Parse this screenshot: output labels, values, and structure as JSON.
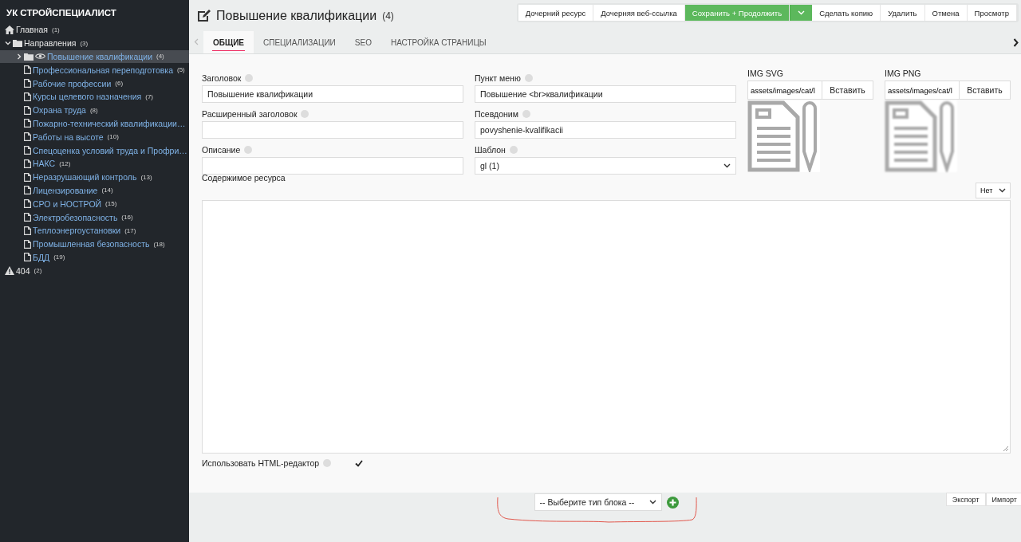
{
  "sidebar": {
    "title": "УК СТРОЙСПЕЦИАЛИСТ",
    "tree": [
      {
        "label": "Главная",
        "count": "(1)",
        "kind": "home",
        "selected": false
      },
      {
        "label": "Направления",
        "count": "(3)",
        "kind": "folder",
        "selected": false,
        "expanded": true,
        "children": [
          {
            "label": "Повышение квалификации",
            "count": "(4)",
            "kind": "folder",
            "selected": true,
            "expanded": false,
            "visible": true
          },
          {
            "label": "Профессиональная переподготовка",
            "count": "(5)",
            "kind": "file",
            "selected": false
          },
          {
            "label": "Рабочие профессии",
            "count": "(6)",
            "kind": "file",
            "selected": false
          },
          {
            "label": "Курсы целевого назначения",
            "count": "(7)",
            "kind": "file",
            "selected": false
          },
          {
            "label": "Охрана труда",
            "count": "(8)",
            "kind": "file",
            "selected": false
          },
          {
            "label": "Пожарно-технический квалификации…",
            "kind": "file",
            "selected": false
          },
          {
            "label": "Работы на высоте",
            "count": "(10)",
            "kind": "file",
            "selected": false
          },
          {
            "label": "Спецоценка условий труда и Профри…",
            "kind": "file",
            "selected": false
          },
          {
            "label": "НАКС",
            "count": "(12)",
            "kind": "file",
            "selected": false
          },
          {
            "label": "Неразрушающий контроль",
            "count": "(13)",
            "kind": "file",
            "selected": false
          },
          {
            "label": "Лицензирование",
            "count": "(14)",
            "kind": "file",
            "selected": false
          },
          {
            "label": "СРО и НОСТРОЙ",
            "count": "(15)",
            "kind": "file",
            "selected": false
          },
          {
            "label": "Электробезопасность",
            "count": "(16)",
            "kind": "file",
            "selected": false
          },
          {
            "label": "Теплоэнергоустановки",
            "count": "(17)",
            "kind": "file",
            "selected": false
          },
          {
            "label": "Промышленная безопасность",
            "count": "(18)",
            "kind": "file",
            "selected": false
          },
          {
            "label": "БДД",
            "count": "(19)",
            "kind": "file",
            "selected": false
          }
        ]
      },
      {
        "label": "404",
        "count": "(2)",
        "kind": "warning",
        "selected": false
      }
    ]
  },
  "header": {
    "title": "Повышение квалификации",
    "count": "(4)",
    "buttons": [
      {
        "label": "Дочерний ресурс",
        "kind": "plain"
      },
      {
        "label": "Дочерняя веб-ссылка",
        "kind": "plain"
      },
      {
        "label": "Сохранить + Продолжить",
        "kind": "primary"
      },
      {
        "label": "Сделать копию",
        "kind": "plain"
      },
      {
        "label": "Удалить",
        "kind": "plain"
      },
      {
        "label": "Отмена",
        "kind": "plain"
      },
      {
        "label": "Просмотр",
        "kind": "plain"
      }
    ]
  },
  "tabs": [
    {
      "label": "ОБЩИЕ",
      "selected": true
    },
    {
      "label": "СПЕЦИАЛИЗАЦИИ",
      "selected": false
    },
    {
      "label": "SEO",
      "selected": false
    },
    {
      "label": "НАСТРОЙКА СТРАНИЦЫ",
      "selected": false
    }
  ],
  "fields_left": [
    {
      "label": "Заголовок",
      "value": "Повышение квалификации",
      "kind": "text"
    },
    {
      "label": "Расширенный заголовок",
      "kind": "text"
    },
    {
      "label": "Описание",
      "kind": "text"
    }
  ],
  "fields_right": [
    {
      "label": "Пункт меню",
      "value": "Повышение  <br>квалификации",
      "kind": "text"
    },
    {
      "label": "Псевдоним",
      "value": "povyshenie-kvalifikacii",
      "kind": "text"
    },
    {
      "label": "Шаблон",
      "value": "gl (1)",
      "kind": "select"
    }
  ],
  "images": [
    {
      "label": "IMG SVG",
      "value": "assets/images/cat/l",
      "button": "Вставить",
      "blurred": false
    },
    {
      "label": "IMG PNG",
      "value": "assets/images/cat/l",
      "button": "Вставить",
      "blurred": true
    }
  ],
  "content": {
    "label": "Содержимое ресурса",
    "editor_select": "Нет"
  },
  "html_editor": {
    "label": "Использовать HTML-редактор",
    "checked": true
  },
  "footer": {
    "block_select": "-- Выберите тип блока --",
    "buttons": [
      "Экспорт",
      "Импорт"
    ]
  }
}
